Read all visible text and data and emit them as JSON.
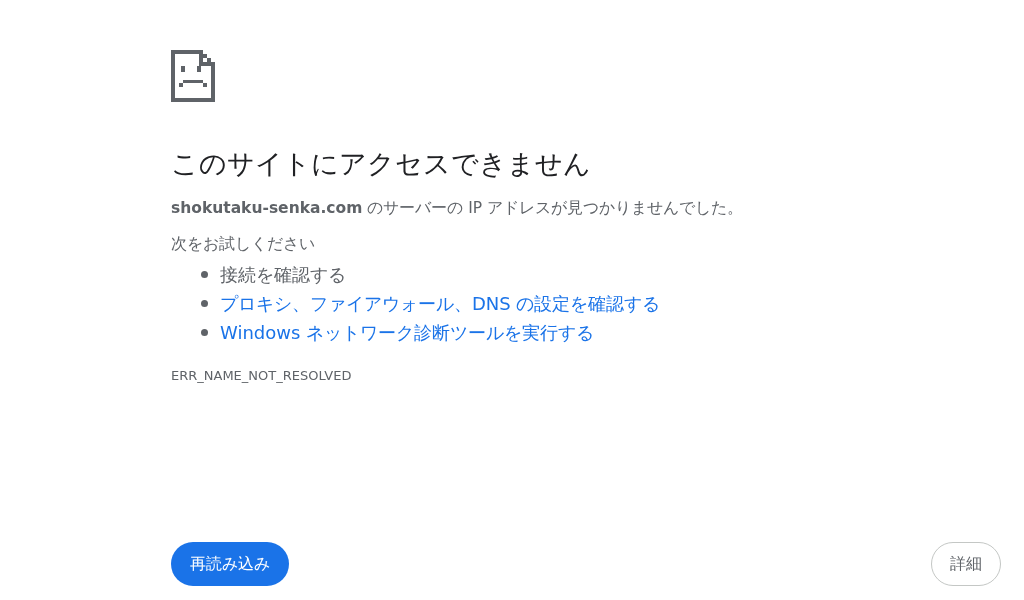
{
  "heading": "このサイトにアクセスできません",
  "message": {
    "host": "shokutaku-senka.com",
    "text": " のサーバーの IP アドレスが見つかりませんでした。"
  },
  "suggestions": {
    "title": "次をお試しください",
    "items": [
      {
        "kind": "text",
        "label": "接続を確認する"
      },
      {
        "kind": "link",
        "label": "プロキシ、ファイアウォール、DNS の設定を確認する"
      },
      {
        "kind": "link",
        "label": "Windows ネットワーク診断ツールを実行する"
      }
    ]
  },
  "error_code": "ERR_NAME_NOT_RESOLVED",
  "buttons": {
    "reload": "再読み込み",
    "details": "詳細"
  }
}
